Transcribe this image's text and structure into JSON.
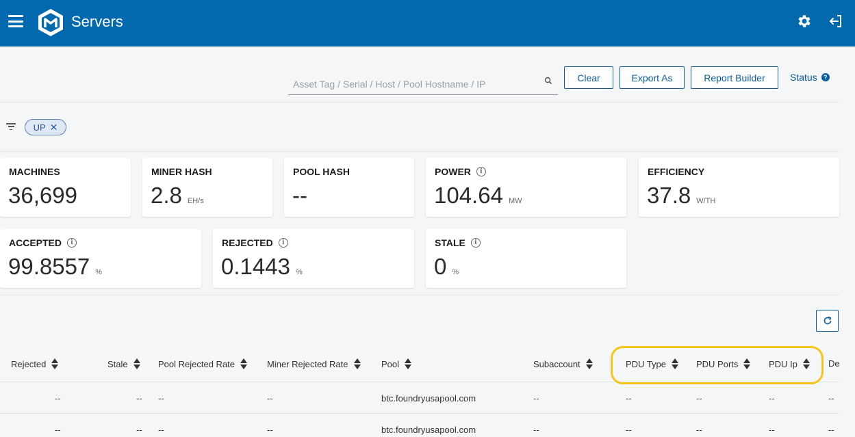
{
  "header": {
    "title": "Servers",
    "bg": "#0369ae"
  },
  "toolbar": {
    "search_placeholder": "Asset Tag / Serial / Host / Pool Hostname / IP",
    "clear_label": "Clear",
    "export_label": "Export As",
    "report_label": "Report Builder",
    "status_label": "Status"
  },
  "filters": {
    "chips": [
      "UP"
    ]
  },
  "stats": {
    "machines": {
      "label": "MACHINES",
      "value": "36,699",
      "unit": ""
    },
    "miner_hash": {
      "label": "MINER HASH",
      "value": "2.8",
      "unit": "EH/s"
    },
    "pool_hash": {
      "label": "POOL HASH",
      "value": "--",
      "unit": ""
    },
    "power": {
      "label": "POWER",
      "value": "104.64",
      "unit": "MW"
    },
    "efficiency": {
      "label": "EFFICIENCY",
      "value": "37.8",
      "unit": "W/TH"
    },
    "accepted": {
      "label": "ACCEPTED",
      "value": "99.8557",
      "unit": "%"
    },
    "rejected": {
      "label": "REJECTED",
      "value": "0.1443",
      "unit": "%"
    },
    "stale": {
      "label": "STALE",
      "value": "0",
      "unit": "%"
    }
  },
  "table": {
    "columns": [
      "Rejected",
      "Stale",
      "Pool Rejected Rate",
      "Miner Rejected Rate",
      "Pool",
      "Subaccount",
      "PDU Type",
      "PDU Ports",
      "PDU Ip",
      "De"
    ],
    "rows": [
      [
        "--",
        "--",
        "--",
        "--",
        "btc.foundryusapool.com",
        "--",
        "--",
        "--",
        "--",
        "--"
      ],
      [
        "--",
        "--",
        "--",
        "--",
        "btc.foundryusapool.com",
        "--",
        "--",
        "--",
        "--",
        "--"
      ]
    ]
  },
  "colors": {
    "accent": "#0a5c9e",
    "highlight": "#f5c518"
  }
}
